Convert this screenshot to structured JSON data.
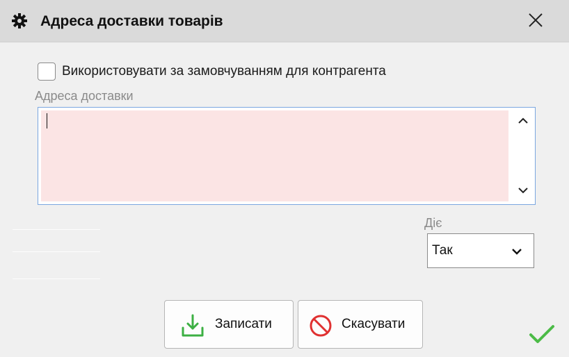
{
  "window": {
    "title": "Адреса доставки товарів"
  },
  "form": {
    "default_checkbox_label": "Використовувати за замовчуванням для контрагента",
    "default_checkbox_checked": false,
    "address_label": "Адреса доставки",
    "address_value": "",
    "status_label": "Діє",
    "status_value": "Так"
  },
  "buttons": {
    "save_label": "Записати",
    "cancel_label": "Скасувати"
  },
  "icons": {
    "title": "gear-icon",
    "close": "close-icon",
    "scroll_up": "chevron-up-icon",
    "scroll_down": "chevron-down-icon",
    "select": "chevron-down-icon",
    "save": "download-tray-icon",
    "cancel": "no-entry-icon",
    "ok": "checkmark-icon"
  },
  "colors": {
    "titlebar": "#dadada",
    "address_required_bg": "#fbe4e4",
    "save_icon": "#3cb043",
    "cancel_icon": "#e03131",
    "ok_check": "#4cbb47"
  }
}
